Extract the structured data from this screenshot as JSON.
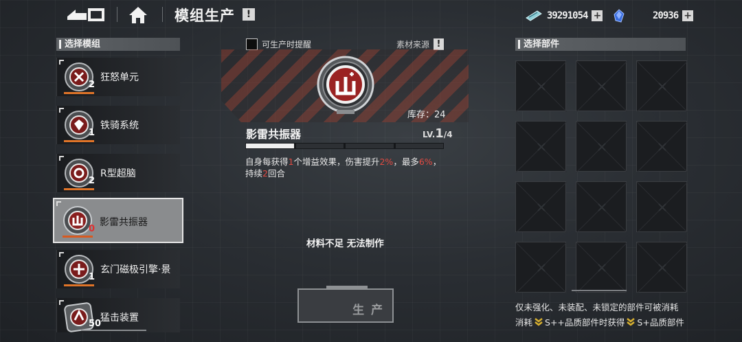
{
  "header": {
    "title": "模组生产",
    "info_label": "!",
    "currencies": [
      {
        "icon": "credit-chip-icon",
        "value": "39291054",
        "plus": "+"
      },
      {
        "icon": "blue-crystal-icon",
        "value": "20936",
        "plus": "+"
      }
    ]
  },
  "left_panel": {
    "header": "选择模组",
    "modules": [
      {
        "name": "狂怒单元",
        "count": "2"
      },
      {
        "name": "铁骑系统",
        "count": "1"
      },
      {
        "name": "R型超脑",
        "count": "2"
      },
      {
        "name": "影雷共振器",
        "count": "0"
      },
      {
        "name": "玄门磁极引擎·景",
        "count": "1"
      },
      {
        "name": "猛击装置",
        "count": "50"
      }
    ]
  },
  "center": {
    "remind_label": "可生产时提醒",
    "source_label": "素材来源",
    "source_info": "!",
    "stock_label": "库存：24",
    "module_title": "影雷共振器",
    "level_prefix": "LV.",
    "level_current": "1",
    "level_max": "/4",
    "level_progress": 0.25,
    "desc": {
      "p1": "自身每获得",
      "n1": "1",
      "p2": "个增益效果，伤害提升",
      "n2": "2%",
      "p3": "，最多",
      "n3": "6%",
      "p4": "，持续",
      "n4": "2",
      "p5": "回合"
    },
    "status": "材料不足 无法制作",
    "produce_label": "生 产"
  },
  "right_panel": {
    "header": "选择部件",
    "note": {
      "line1": "仅未强化、未装配、未锁定的部件可被消耗",
      "prefix": "消耗",
      "rank1": "S++品质部件时获得",
      "rank2": "S+品质部件"
    }
  },
  "colors": {
    "accent_red": "#e24a42",
    "bar_orange": "#e07428",
    "rank_gold": "#d8b030"
  }
}
